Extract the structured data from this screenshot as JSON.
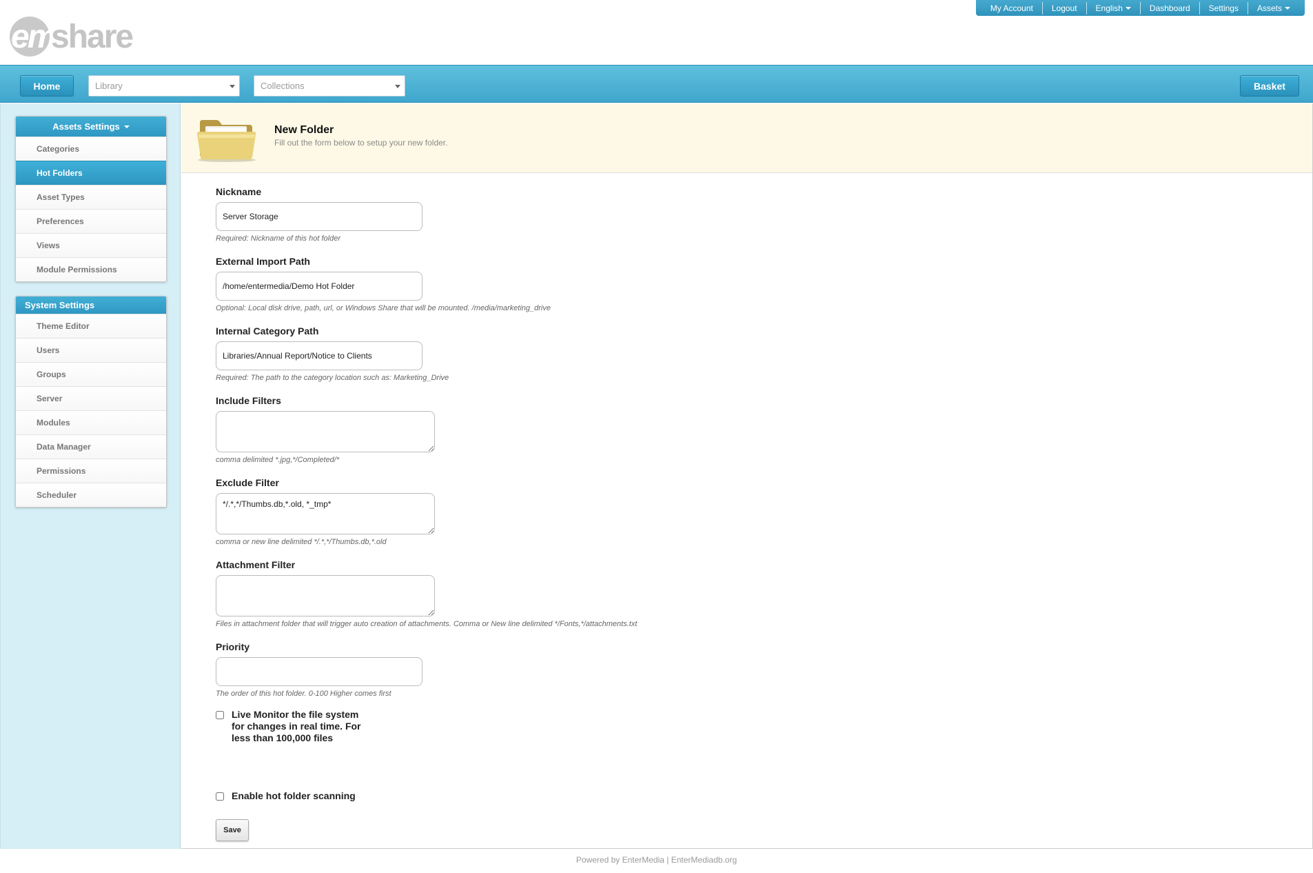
{
  "brand": {
    "logo_em": "em",
    "logo_share": "share"
  },
  "topnav": {
    "items": [
      {
        "label": "My Account",
        "dropdown": false
      },
      {
        "label": "Logout",
        "dropdown": false
      },
      {
        "label": "English",
        "dropdown": true
      },
      {
        "label": "Dashboard",
        "dropdown": false
      },
      {
        "label": "Settings",
        "dropdown": false
      },
      {
        "label": "Assets",
        "dropdown": true
      }
    ]
  },
  "navbar": {
    "home_label": "Home",
    "library_placeholder": "Library",
    "collections_placeholder": "Collections",
    "basket_label": "Basket"
  },
  "sidebar": {
    "assets_settings": {
      "title": "Assets Settings",
      "items": [
        "Categories",
        "Hot Folders",
        "Asset Types",
        "Preferences",
        "Views",
        "Module Permissions"
      ],
      "active": "Hot Folders"
    },
    "system_settings": {
      "title": "System Settings",
      "items": [
        "Theme Editor",
        "Users",
        "Groups",
        "Server",
        "Modules",
        "Data Manager",
        "Permissions",
        "Scheduler"
      ]
    }
  },
  "page": {
    "title": "New Folder",
    "subtitle": "Fill out the form below to setup your new folder."
  },
  "form": {
    "nickname": {
      "label": "Nickname",
      "value": "Server Storage",
      "help": "Required: Nickname of this hot folder"
    },
    "external_import_path": {
      "label": "External Import Path",
      "value": "/home/entermedia/Demo Hot Folder",
      "help": "Optional: Local disk drive, path, url, or Windows Share that will be mounted. /media/marketing_drive"
    },
    "internal_category_path": {
      "label": "Internal Category Path",
      "value": "Libraries/Annual Report/Notice to Clients",
      "help": "Required: The path to the category location such as: Marketing_Drive"
    },
    "include_filters": {
      "label": "Include Filters",
      "value": "",
      "help": "comma delimited *.jpg,*/Completed/*"
    },
    "exclude_filter": {
      "label": "Exclude Filter",
      "value": "*/.*,*/Thumbs.db,*.old, *_tmp*",
      "help": "comma or new line delimited */.*,*/Thumbs.db,*.old"
    },
    "attachment_filter": {
      "label": "Attachment Filter",
      "value": "",
      "help": "Files in attachment folder that will trigger auto creation of attachments. Comma or New line delimited */Fonts,*/attachments.txt"
    },
    "priority": {
      "label": "Priority",
      "value": "",
      "help": "The order of this hot folder. 0-100 Higher comes first"
    },
    "live_monitor": {
      "lines": [
        "Live Monitor the file system",
        "for changes in real time. For",
        "less than 100,000 files"
      ],
      "checked": false
    },
    "enable_scanning": {
      "label": "Enable hot folder scanning",
      "checked": false
    },
    "save_label": "Save"
  },
  "footer": {
    "text": "Powered by EnterMedia | EnterMediadb.org"
  },
  "colors": {
    "accent": "#3fa6cd",
    "sidebar_bg": "#d6eef6",
    "header_bg": "#fdf9e6"
  }
}
